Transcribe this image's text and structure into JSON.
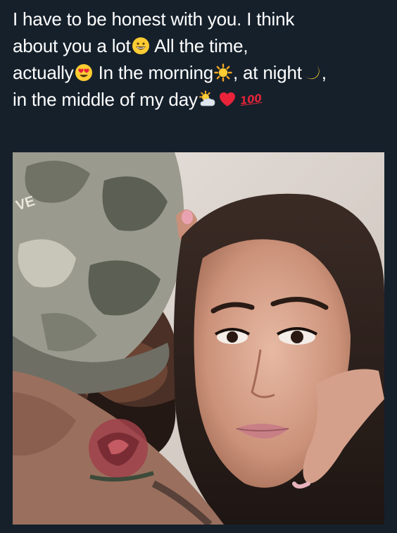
{
  "tweet": {
    "line1": "I have to be honest with you. I think",
    "line2_a": "about you a lot",
    "line2_b": " All the time,",
    "line3_a": "actually",
    "line3_b": " In the morning",
    "line3_c": ", at night",
    "line3_d": ",",
    "line4_a": "in the middle of my day",
    "hundred": "100"
  },
  "emojis": [
    "grinning-face-icon",
    "heart-eyes-icon",
    "sun-icon",
    "crescent-moon-icon",
    "sun-behind-cloud-icon",
    "red-heart-icon",
    "hundred-points-icon"
  ],
  "photo": {
    "cap_text": "VE"
  },
  "colors": {
    "background": "#15202b",
    "text": "#ffffff"
  }
}
